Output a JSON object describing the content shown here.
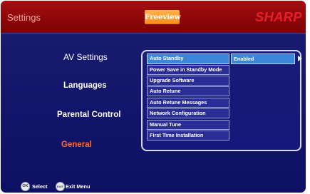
{
  "header": {
    "title": "Settings",
    "channel_logo": "Freeview",
    "brand": "SHARP"
  },
  "categories": [
    {
      "label": "AV Settings"
    },
    {
      "label": "Languages"
    },
    {
      "label": "Parental Control"
    },
    {
      "label": "General"
    }
  ],
  "menu": {
    "items": [
      {
        "label": "Auto Standby"
      },
      {
        "label": "Power Save in Standby Mode"
      },
      {
        "label": "Upgrade Software"
      },
      {
        "label": "Auto Retune"
      },
      {
        "label": "Auto Retune Messages"
      },
      {
        "label": "Network Configuration"
      },
      {
        "label": "Manual Tune"
      },
      {
        "label": "First Time Installation"
      }
    ],
    "selected_value": "Enabled"
  },
  "footer": {
    "select_icon": "OK",
    "select_label": "Select",
    "exit_icon": "EXIT",
    "exit_label": "Exit Menu"
  },
  "colors": {
    "header_red": "#8c0608",
    "background_blue": "#13156a",
    "highlight_blue": "#3c86d9",
    "active_category": "#ff6a33",
    "brand_red": "#e51f2b"
  }
}
